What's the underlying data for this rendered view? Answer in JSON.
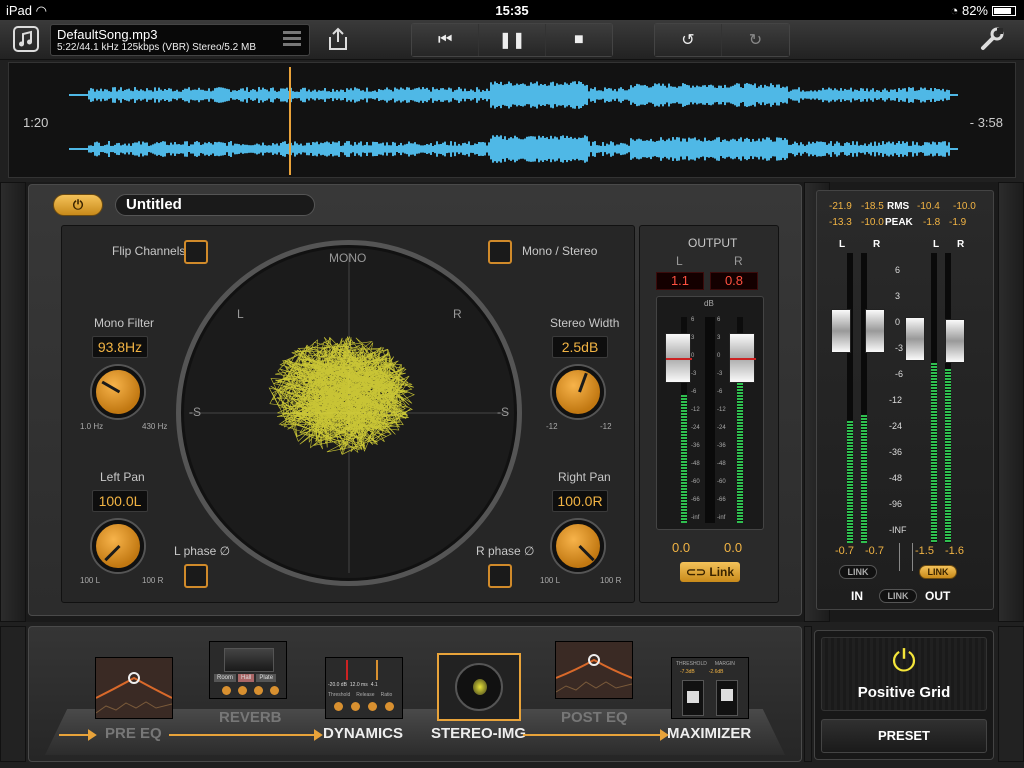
{
  "status": {
    "device": "iPad",
    "time": "15:35",
    "battery": "82%"
  },
  "toolbar": {
    "song_title": "DefaultSong.mp3",
    "song_info": "5:22/44.1 kHz 125kbps (VBR) Stereo/5.2 MB"
  },
  "waveform": {
    "elapsed": "1:20",
    "remaining": "- 3:58",
    "color": "#4fb8e6"
  },
  "preset": {
    "name": "Untitled"
  },
  "imager": {
    "flip_channels": "Flip Channels",
    "mono_stereo": "Mono / Stereo",
    "mono_label": "MONO",
    "l_label": "L",
    "r_label": "R",
    "s_left": "-S",
    "s_right": "-S",
    "mono_filter": {
      "label": "Mono Filter",
      "value": "93.8Hz",
      "min": "1.0 Hz",
      "max": "430 Hz"
    },
    "stereo_width": {
      "label": "Stereo Width",
      "value": "2.5dB",
      "min": "-12",
      "max": "-12"
    },
    "left_pan": {
      "label": "Left Pan",
      "value": "100.0L",
      "min": "100 L",
      "max": "100 R"
    },
    "right_pan": {
      "label": "Right Pan",
      "value": "100.0R",
      "min": "100 L",
      "max": "100 R"
    },
    "l_phase": "L phase ∅",
    "r_phase": "R phase ∅"
  },
  "output": {
    "title": "OUTPUT",
    "l": "L",
    "r": "R",
    "peak_l": "1.1",
    "peak_r": "0.8",
    "db": "dB",
    "scale": [
      "6",
      "3",
      "0",
      "-3",
      "-6",
      "-12",
      "-24",
      "-36",
      "-48",
      "-60",
      "-66",
      "-inf"
    ],
    "val_l": "0.0",
    "val_r": "0.0",
    "link": "Link"
  },
  "meters": {
    "rms_in_l": "-21.9",
    "rms_in_r": "-18.5",
    "rms_label": "RMS",
    "rms_out_l": "-10.4",
    "rms_out_r": "-10.0",
    "peak_in_l": "-13.3",
    "peak_in_r": "-10.0",
    "peak_label": "PEAK",
    "peak_out_l": "-1.8",
    "peak_out_r": "-1.9",
    "in_l": "L",
    "in_r": "R",
    "out_l": "L",
    "out_r": "R",
    "scale": [
      "6",
      "3",
      "0",
      "-3",
      "-6",
      "-12",
      "-24",
      "-36",
      "-48",
      "-96",
      "-INF"
    ],
    "in_val_l": "-0.7",
    "in_val_r": "-0.7",
    "out_val_l": "-1.5",
    "out_val_r": "-1.6",
    "link": "LINK",
    "in": "IN",
    "out": "OUT"
  },
  "chain": {
    "pre_eq": "PRE EQ",
    "reverb": "REVERB",
    "reverb_tabs": [
      "Room",
      "Hall",
      "Plate"
    ],
    "dynamics": "DYNAMICS",
    "stereo_img": "STEREO-IMG",
    "post_eq": "POST EQ",
    "maximizer": "MAXIMIZER",
    "dyn_vals": [
      "-20.0 dB",
      "12.0 ms",
      "4.1"
    ],
    "dyn_labels": [
      "Threshold",
      "Release",
      "Ratio"
    ],
    "max_labels": [
      "THRESHOLD",
      "MARGIN"
    ],
    "max_vals": [
      "-7.3dB",
      "-2.6dB"
    ]
  },
  "brand": {
    "name": "Positive Grid",
    "preset_button": "PRESET"
  },
  "colors": {
    "accent": "#e8a33a",
    "scope": "#e6e23a",
    "meter_green": "#2fbf4f"
  }
}
